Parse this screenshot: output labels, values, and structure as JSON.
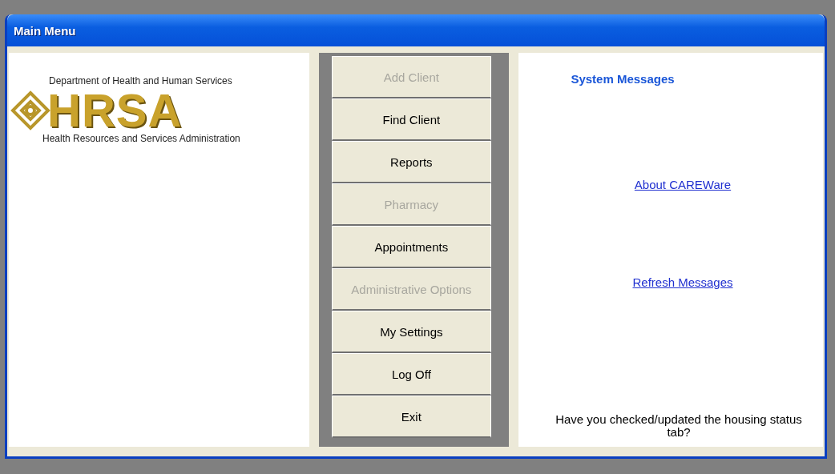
{
  "window": {
    "title": "Main Menu"
  },
  "logo": {
    "top_text": "Department of Health and Human Services",
    "wordmark": "HRSA",
    "bottom_text": "Health Resources and Services Administration"
  },
  "menu_buttons": [
    {
      "label": "Add Client",
      "disabled": true
    },
    {
      "label": "Find Client",
      "disabled": false
    },
    {
      "label": "Reports",
      "disabled": false
    },
    {
      "label": "Pharmacy",
      "disabled": true
    },
    {
      "label": "Appointments",
      "disabled": false
    },
    {
      "label": "Administrative Options",
      "disabled": true
    },
    {
      "label": "My Settings",
      "disabled": false
    },
    {
      "label": "Log Off",
      "disabled": false
    },
    {
      "label": "Exit",
      "disabled": false
    }
  ],
  "messages": {
    "title": "System Messages",
    "links": [
      "About CAREWare",
      "Refresh Messages"
    ],
    "notice": "Have you checked/updated the housing status tab?"
  }
}
